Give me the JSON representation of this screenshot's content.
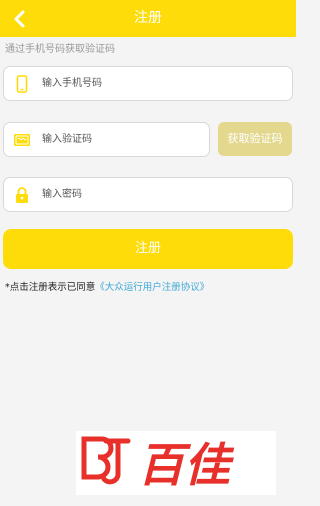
{
  "header": {
    "title": "注册",
    "back_icon": "chevron-left-icon"
  },
  "hint": "通过手机号码获取验证码",
  "phone": {
    "placeholder": "输入手机号码",
    "icon": "phone-icon"
  },
  "code": {
    "placeholder": "输入验证码",
    "icon": "sms-code-icon",
    "button_label": "获取验证码"
  },
  "password": {
    "placeholder": "输入密码",
    "icon": "lock-icon"
  },
  "register_button": "注册",
  "agreement": {
    "prefix": "*点击注册表示已同意",
    "link": "《大众运行用户注册协议》"
  },
  "watermark": {
    "text": "百佳"
  },
  "colors": {
    "accent": "#fedc0a",
    "code_button": "#e3d88e",
    "link": "#3fa9d6",
    "watermark_red": "#e8302b"
  }
}
